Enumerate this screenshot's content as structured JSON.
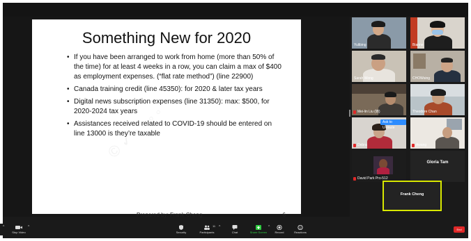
{
  "slide": {
    "title": "Something New for 2020",
    "bullets": [
      "If you have been arranged to work from home (more than 50% of the time) for at least 4 weeks in a row, you can claim a max of $400 as employment expenses. (“flat rate method”) (line 22900)",
      "Canada training credit (line 45350): for 2020 & later tax years",
      "Digital news subscription expenses (line 31350): max: $500, for 2020-2024 tax years",
      "Assistances received related to COVID-19 should be entered on line 13000 is they’re taxable"
    ],
    "footer_author": "Prepared by: Frank Cheng",
    "page_number": "6"
  },
  "gallery": {
    "tiles": [
      {
        "name": "Yulibing",
        "muted": false
      },
      {
        "name": "Bianne",
        "muted": false
      },
      {
        "name": "Sarah Wong",
        "muted": false
      },
      {
        "name": "CHOWsing",
        "muted": false
      },
      {
        "name": "Mei-lin Liu (她)",
        "muted": true
      },
      {
        "name": "Theodore Chan",
        "muted": false
      },
      {
        "name": "Debra",
        "muted": true
      },
      {
        "name": "Awang",
        "muted": true
      },
      {
        "name": "David Park Pro-512",
        "muted": true
      }
    ],
    "unmute_prompt": "Ask to Unmute",
    "unmute_chevron": "⌄",
    "name_only_tile": "Gloria Tam",
    "active_speaker": "Frank Cheng"
  },
  "controls": {
    "items": [
      {
        "label": "Stop Video",
        "icon": "video-camera-icon"
      },
      {
        "label": "Security",
        "icon": "shield-icon"
      },
      {
        "label": "Participants",
        "icon": "participants-icon"
      },
      {
        "label": "Chat",
        "icon": "chat-icon"
      },
      {
        "label": "Share Screen",
        "icon": "share-screen-icon"
      },
      {
        "label": "Record",
        "icon": "record-icon"
      },
      {
        "label": "Reactions",
        "icon": "reactions-icon"
      }
    ],
    "participant_count": "11",
    "end_label": "End",
    "caret": "^",
    "share_color": "#2ecc40",
    "end_color": "#e02828"
  }
}
